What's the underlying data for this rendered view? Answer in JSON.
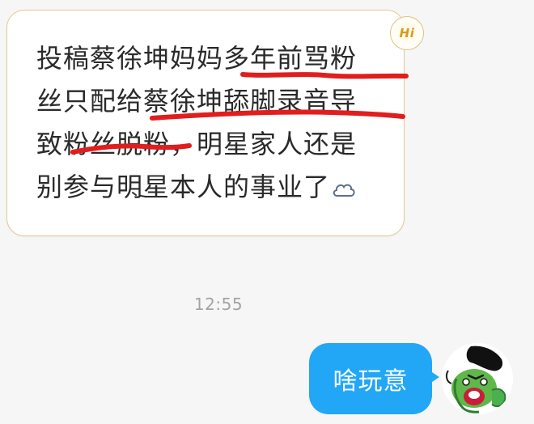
{
  "conversation": {
    "incoming_message": {
      "lines": [
        "投稿蔡徐坤妈妈多年前骂粉",
        "丝只配给蔡徐坤舔脚录音导",
        "致粉丝脱粉，明星家人还是",
        "别参与明星本人的事业了"
      ],
      "emoji": "cloud-icon",
      "badge": "Hi"
    },
    "timestamp": "12:55",
    "outgoing_message": {
      "text": "啥玩意"
    }
  },
  "colors": {
    "incoming_bubble_bg": "#ffffff",
    "incoming_bubble_border": "#e3c98f",
    "outgoing_bubble_bg": "#21a7f6",
    "annotation_underline": "#e11d1d",
    "timestamp": "#a3a3a3",
    "background": "#f6f6f6"
  }
}
